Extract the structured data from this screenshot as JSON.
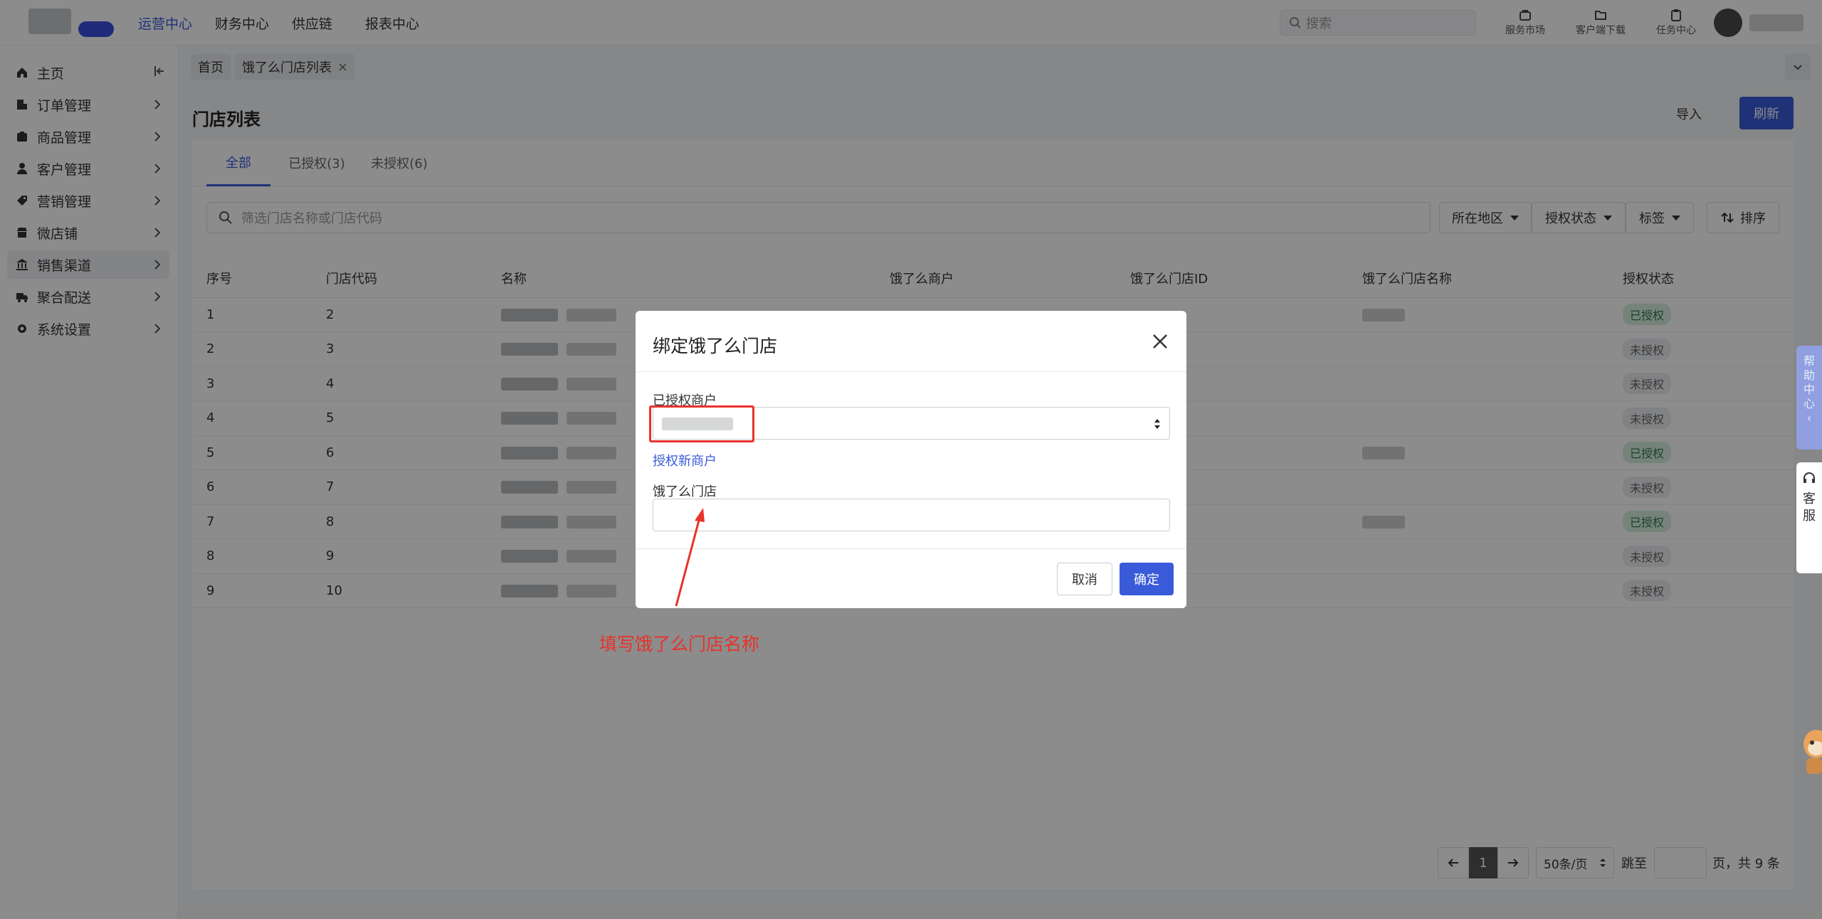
{
  "topbar": {
    "nav": [
      {
        "label": "运营中心",
        "active": true
      },
      {
        "label": "财务中心",
        "active": false
      },
      {
        "label": "供应链",
        "active": false
      },
      {
        "label": "报表中心",
        "active": false
      }
    ],
    "search_placeholder": "搜索",
    "tools": [
      {
        "label": "服务市场",
        "icon": "shop-icon"
      },
      {
        "label": "客户端下载",
        "icon": "folder-download-icon"
      },
      {
        "label": "任务中心",
        "icon": "clipboard-icon"
      }
    ]
  },
  "sidebar": {
    "items": [
      {
        "label": "主页",
        "icon": "home-icon"
      },
      {
        "label": "订单管理",
        "icon": "order-icon"
      },
      {
        "label": "商品管理",
        "icon": "box-icon"
      },
      {
        "label": "客户管理",
        "icon": "user-icon"
      },
      {
        "label": "营销管理",
        "icon": "tag-icon"
      },
      {
        "label": "微店铺",
        "icon": "store-icon"
      },
      {
        "label": "销售渠道",
        "icon": "bank-icon"
      },
      {
        "label": "聚合配送",
        "icon": "truck-icon"
      },
      {
        "label": "系统设置",
        "icon": "gear-icon"
      }
    ],
    "active_index": 6
  },
  "tags": [
    {
      "label": "首页"
    },
    {
      "label": "饿了么门店列表",
      "closable": "×"
    }
  ],
  "page": {
    "title": "门店列表",
    "import_label": "导入",
    "refresh_label": "刷新"
  },
  "tabs": [
    {
      "label": "全部",
      "active": true
    },
    {
      "label": "已授权(3)",
      "active": false
    },
    {
      "label": "未授权(6)",
      "active": false
    }
  ],
  "filters": {
    "search_placeholder": "筛选门店名称或门店代码",
    "region": "所在地区",
    "auth_status": "授权状态",
    "tag": "标签",
    "sort": "排序"
  },
  "table": {
    "headers": [
      "序号",
      "门店代码",
      "名称",
      "饿了么商户",
      "饿了么门店ID",
      "饿了么门店名称",
      "授权状态"
    ],
    "rows": [
      {
        "index": "1",
        "code": "2",
        "status": "已授权",
        "ok": true
      },
      {
        "index": "2",
        "code": "3",
        "status": "未授权",
        "ok": false
      },
      {
        "index": "3",
        "code": "4",
        "status": "未授权",
        "ok": false
      },
      {
        "index": "4",
        "code": "5",
        "status": "未授权",
        "ok": false
      },
      {
        "index": "5",
        "code": "6",
        "status": "已授权",
        "ok": true
      },
      {
        "index": "6",
        "code": "7",
        "status": "未授权",
        "ok": false
      },
      {
        "index": "7",
        "code": "8",
        "status": "已授权",
        "ok": true
      },
      {
        "index": "8",
        "code": "9",
        "status": "未授权",
        "ok": false
      },
      {
        "index": "9",
        "code": "10",
        "status": "未授权",
        "ok": false
      }
    ]
  },
  "pager": {
    "current": "1",
    "page_size": "50条/页",
    "jump_label": "跳至",
    "total_label": "页，共 9 条"
  },
  "floats": {
    "help": [
      "帮",
      "助",
      "中",
      "心",
      "‹"
    ],
    "kefu": [
      "客",
      "服"
    ]
  },
  "modal": {
    "title": "绑定饿了么门店",
    "merchant_label": "已授权商户",
    "auth_link": "授权新商户",
    "store_label": "饿了么门店",
    "cancel_label": "取消",
    "ok_label": "确定"
  },
  "annotation": {
    "text": "填写饿了么门店名称",
    "color": "#e8322b"
  },
  "colors": {
    "accent": "#3a5bd9",
    "authorized_badge": "#d8efe1",
    "unauthorized_badge": "#ebedf0"
  }
}
